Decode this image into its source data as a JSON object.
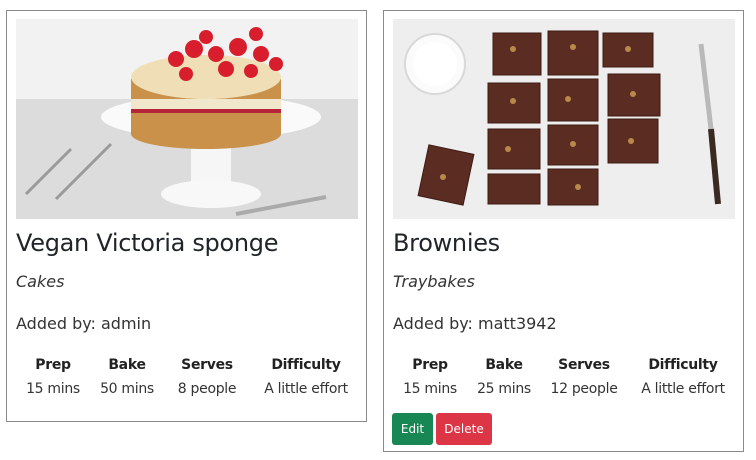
{
  "recipes": [
    {
      "title": "Vegan Victoria sponge",
      "category": "Cakes",
      "added_by": "Added by: admin",
      "stats": [
        {
          "label": "Prep",
          "value": "15 mins"
        },
        {
          "label": "Bake",
          "value": "50 mins"
        },
        {
          "label": "Serves",
          "value": "8 people"
        },
        {
          "label": "Difficulty",
          "value": "A little effort"
        }
      ]
    },
    {
      "title": "Brownies",
      "category": "Traybakes",
      "added_by": "Added by: matt3942",
      "stats": [
        {
          "label": "Prep",
          "value": "15 mins"
        },
        {
          "label": "Bake",
          "value": "25 mins"
        },
        {
          "label": "Serves",
          "value": "12 people"
        },
        {
          "label": "Difficulty",
          "value": "A little effort"
        }
      ],
      "actions": {
        "edit_label": "Edit",
        "delete_label": "Delete"
      }
    }
  ],
  "colors": {
    "edit": "#198754",
    "delete": "#dc3545",
    "card_border": "#8a8a8a"
  }
}
